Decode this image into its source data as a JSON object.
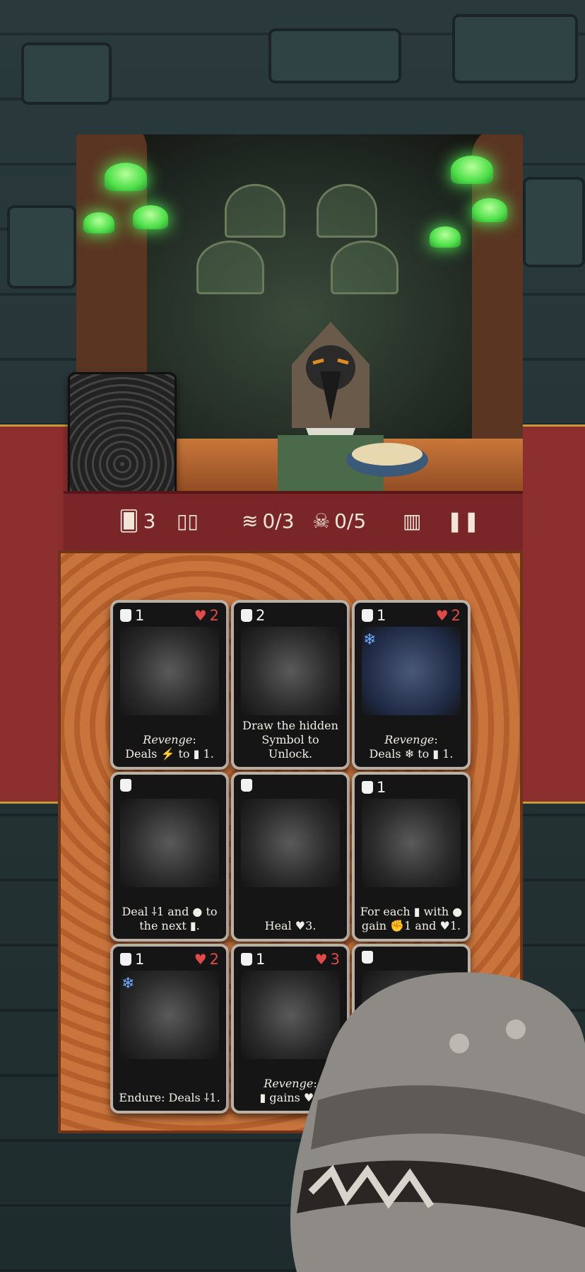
{
  "hud": {
    "discard_count": "3",
    "cards_played": "0/3",
    "kills": "0/5"
  },
  "cards": [
    {
      "cost": "1",
      "hp": "2",
      "line1_italic": "Revenge",
      "line1_rest": ":",
      "line2": "Deals ⚡ to ▮ 1."
    },
    {
      "cost": "2",
      "hp": "",
      "line1_italic": "",
      "line1_rest": "Draw the hidden",
      "line2": "Symbol to Unlock."
    },
    {
      "cost": "1",
      "hp": "2",
      "line1_italic": "Revenge",
      "line1_rest": ":",
      "line2": "Deals ❄ to ▮ 1."
    },
    {
      "cost": "",
      "hp": "",
      "line1_italic": "",
      "line1_rest": "Deal ⸸1 and ● to",
      "line2": "the next ▮."
    },
    {
      "cost": "",
      "hp": "",
      "line1_italic": "",
      "line1_rest": "",
      "line2": "Heal ♥3."
    },
    {
      "cost": "1",
      "hp": "",
      "line1_italic": "",
      "line1_rest": "For each ▮ with ●",
      "line2": "gain ✊1 and ♥1."
    },
    {
      "cost": "1",
      "hp": "2",
      "line1_italic": "",
      "line1_rest": "",
      "line2": "Endure: Deals ⸸1."
    },
    {
      "cost": "1",
      "hp": "3",
      "line1_italic": "Revenge",
      "line1_rest": ":",
      "line2": "▮ gains ♥1"
    },
    {
      "cost": "",
      "hp": "",
      "line1_italic": "",
      "line1_rest": "",
      "line2": ""
    }
  ]
}
